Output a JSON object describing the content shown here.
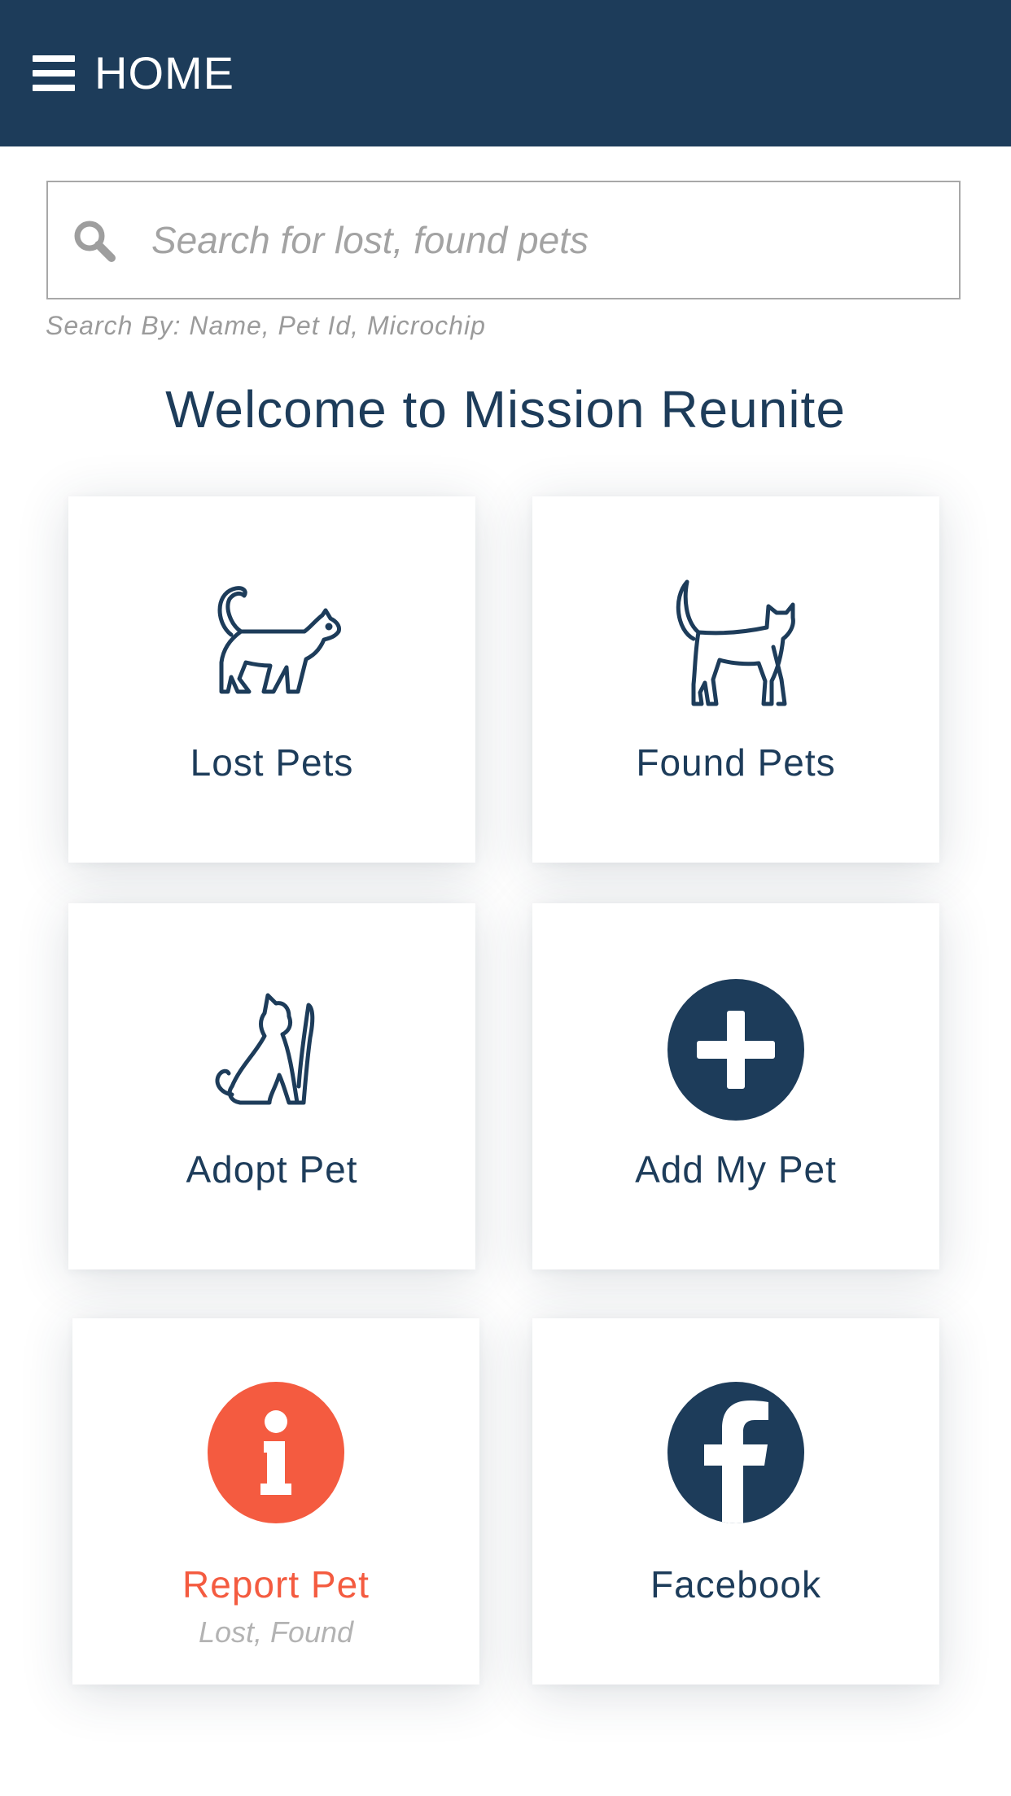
{
  "header": {
    "title": "HOME",
    "menu_icon": "hamburger-menu-icon"
  },
  "search": {
    "icon": "search-icon",
    "placeholder": "Search for lost, found pets",
    "value": "",
    "hint": "Search By: Name, Pet Id, Microchip"
  },
  "welcome": "Welcome to Mission Reunite",
  "colors": {
    "brand": "#1d3c5a",
    "accent": "#f45b40",
    "muted": "#a3a3a3"
  },
  "tiles": [
    {
      "label": "Lost Pets",
      "icon": "walking-cat-icon"
    },
    {
      "label": "Found Pets",
      "icon": "standing-cat-icon"
    },
    {
      "label": "Adopt Pet",
      "icon": "sitting-cat-icon"
    },
    {
      "label": "Add My Pet",
      "icon": "add-circle-icon"
    },
    {
      "label": "Report Pet",
      "sublabel": "Lost, Found",
      "icon": "info-circle-icon"
    },
    {
      "label": "Facebook",
      "icon": "facebook-icon"
    }
  ]
}
